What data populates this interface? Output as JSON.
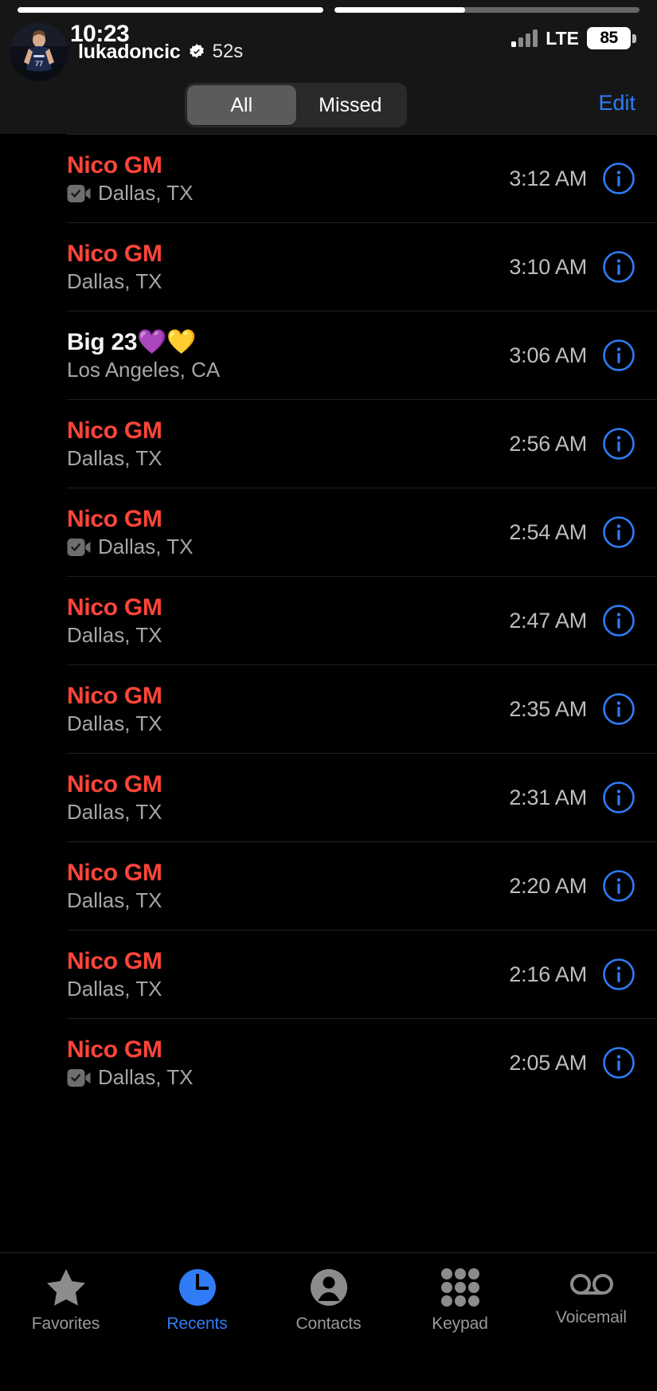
{
  "story": {
    "username": "lukadoncic",
    "time_ago": "52s",
    "verified_icon": "verified-badge-icon",
    "avatar_alt": "luka-doncic-avatar",
    "progress": [
      {
        "percent": 100
      },
      {
        "percent": 43
      }
    ]
  },
  "status_bar": {
    "time": "10:23",
    "carrier": "LTE",
    "battery_percent": "85",
    "signal_bars_filled": 1,
    "signal_bars_total": 4
  },
  "navbar": {
    "segments": [
      {
        "label": "All",
        "selected": true
      },
      {
        "label": "Missed",
        "selected": false
      }
    ],
    "edit_label": "Edit"
  },
  "calls": [
    {
      "name": "Nico GM",
      "missed": true,
      "location": "Dallas, TX",
      "video": true,
      "time": "3:12 AM",
      "info_icon": "info-circle-icon"
    },
    {
      "name": "Nico GM",
      "missed": true,
      "location": "Dallas, TX",
      "video": false,
      "time": "3:10 AM",
      "info_icon": "info-circle-icon"
    },
    {
      "name": "Big 23💜💛",
      "missed": false,
      "location": "Los Angeles, CA",
      "video": false,
      "time": "3:06 AM",
      "info_icon": "info-circle-icon"
    },
    {
      "name": "Nico GM",
      "missed": true,
      "location": "Dallas, TX",
      "video": false,
      "time": "2:56 AM",
      "info_icon": "info-circle-icon"
    },
    {
      "name": "Nico GM",
      "missed": true,
      "location": "Dallas, TX",
      "video": true,
      "time": "2:54 AM",
      "info_icon": "info-circle-icon"
    },
    {
      "name": "Nico GM",
      "missed": true,
      "location": "Dallas, TX",
      "video": false,
      "time": "2:47 AM",
      "info_icon": "info-circle-icon"
    },
    {
      "name": "Nico GM",
      "missed": true,
      "location": "Dallas, TX",
      "video": false,
      "time": "2:35 AM",
      "info_icon": "info-circle-icon"
    },
    {
      "name": "Nico GM",
      "missed": true,
      "location": "Dallas, TX",
      "video": false,
      "time": "2:31 AM",
      "info_icon": "info-circle-icon"
    },
    {
      "name": "Nico GM",
      "missed": true,
      "location": "Dallas, TX",
      "video": false,
      "time": "2:20 AM",
      "info_icon": "info-circle-icon"
    },
    {
      "name": "Nico GM",
      "missed": true,
      "location": "Dallas, TX",
      "video": false,
      "time": "2:16 AM",
      "info_icon": "info-circle-icon"
    },
    {
      "name": "Nico GM",
      "missed": true,
      "location": "Dallas, TX",
      "video": true,
      "time": "2:05 AM",
      "info_icon": "info-circle-icon"
    }
  ],
  "tabbar": {
    "tabs": [
      {
        "label": "Favorites",
        "icon": "star-icon",
        "active": false
      },
      {
        "label": "Recents",
        "icon": "clock-icon",
        "active": true
      },
      {
        "label": "Contacts",
        "icon": "person-icon",
        "active": false
      },
      {
        "label": "Keypad",
        "icon": "keypad-icon",
        "active": false
      },
      {
        "label": "Voicemail",
        "icon": "voicemail-icon",
        "active": false
      }
    ]
  },
  "colors": {
    "missed_red": "#ff453a",
    "accent_blue": "#2f7cf6",
    "background": "#000000",
    "story_bg": "#161616"
  }
}
